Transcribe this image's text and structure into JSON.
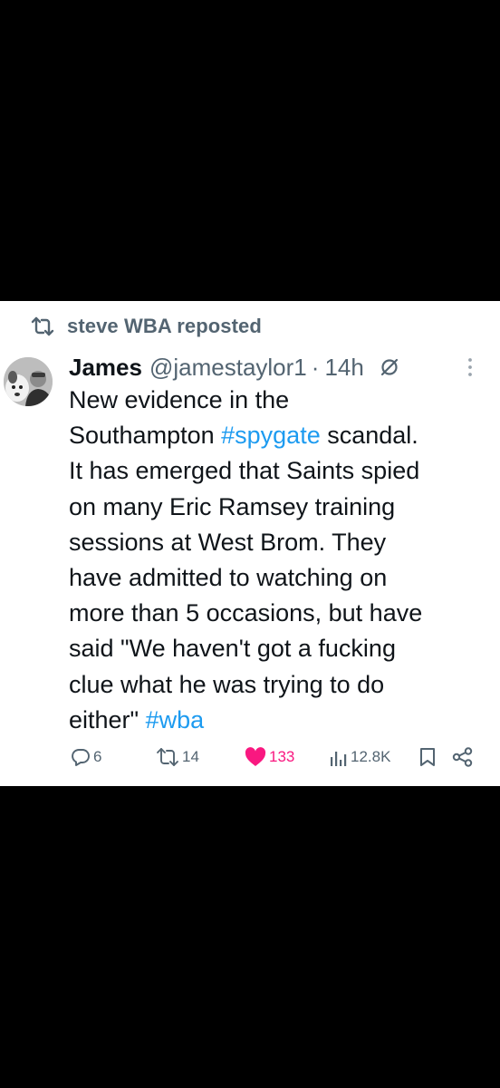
{
  "repost": {
    "text": "steve WBA reposted"
  },
  "post": {
    "author_name": "James",
    "author_handle": "@jamestaylor1",
    "separator": "·",
    "time": "14h",
    "body": {
      "line1": "New evidence in the",
      "line2_pre": "Southampton ",
      "hashtag1": "#spygate",
      "line2_post": " scandal.",
      "line3": "It has emerged that Saints spied",
      "line4": "on many Eric Ramsey training",
      "line5": "sessions at West Brom. They",
      "line6": "have admitted to watching on",
      "line7": "more than 5 occasions, but have",
      "line8": "said \"We haven't got a fucking",
      "line9": "clue what he was trying to do",
      "line10_pre": "either\" ",
      "hashtag2": "#wba"
    }
  },
  "actions": {
    "replies": "6",
    "reposts": "14",
    "likes": "133",
    "views": "12.8K"
  },
  "colors": {
    "background": "#ffffff",
    "text": "#0f1419",
    "secondary": "#536471",
    "hashtag": "#1d9bf0",
    "like": "#f91880"
  },
  "icons": [
    "repost-icon",
    "avatar",
    "muted-icon",
    "more-icon",
    "reply-icon",
    "like-icon",
    "views-icon",
    "bookmark-icon",
    "share-icon"
  ]
}
